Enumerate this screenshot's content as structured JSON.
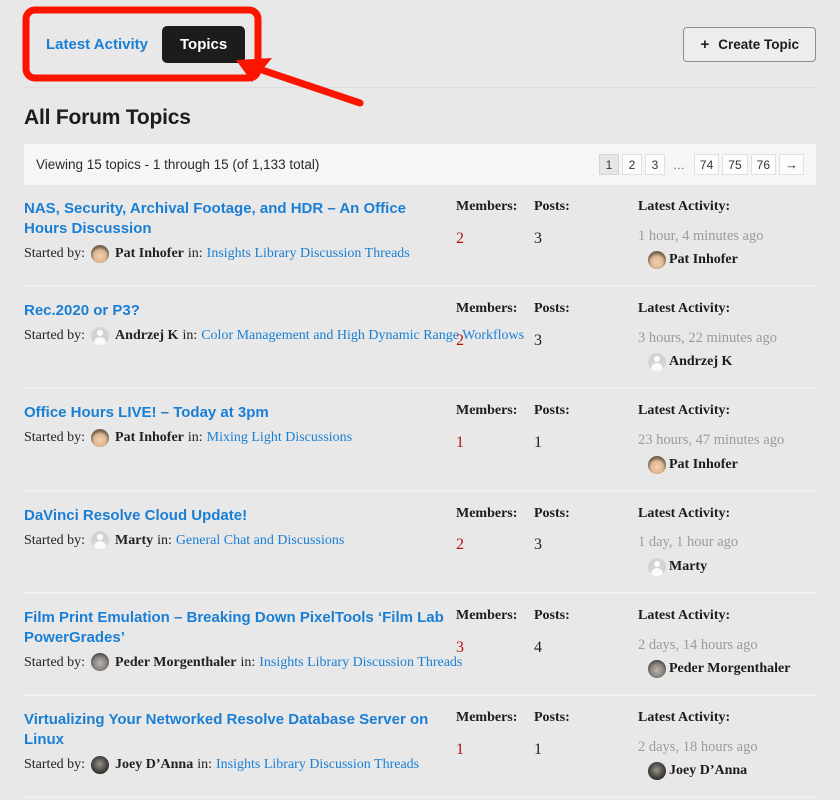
{
  "header": {
    "tab_latest_activity": "Latest Activity",
    "tab_topics": "Topics",
    "create_topic_label": "Create Topic",
    "plus_glyph": "+"
  },
  "page_title": "All Forum Topics",
  "viewbar": {
    "text": "Viewing 15 topics - 1 through 15 (of 1,133 total)",
    "pagination": [
      "1",
      "2",
      "3",
      "…",
      "74",
      "75",
      "76",
      "→"
    ],
    "current_page": "1"
  },
  "columns": {
    "members": "Members:",
    "posts": "Posts:",
    "latest_activity": "Latest Activity:",
    "started_by": "Started by:",
    "in": "in:"
  },
  "topics": [
    {
      "title": "NAS, Security, Archival Footage, and HDR – An Office Hours Discussion",
      "author": "Pat Inhofer",
      "author_avatar": "photo-pat",
      "forum": "Insights Library Discussion Threads",
      "members": "2",
      "posts": "3",
      "activity_time": "1 hour, 4 minutes ago",
      "activity_user": "Pat Inhofer",
      "activity_avatar": "photo-pat"
    },
    {
      "title": "Rec.2020 or P3?",
      "author": "Andrzej K",
      "author_avatar": "generic",
      "forum": "Color Management and High Dynamic Range Workflows",
      "members": "2",
      "posts": "3",
      "activity_time": "3 hours, 22 minutes ago",
      "activity_user": "Andrzej K",
      "activity_avatar": "generic"
    },
    {
      "title": "Office Hours LIVE! – Today at 3pm",
      "author": "Pat Inhofer",
      "author_avatar": "photo-pat",
      "forum": "Mixing Light Discussions",
      "members": "1",
      "posts": "1",
      "activity_time": "23 hours, 47 minutes ago",
      "activity_user": "Pat Inhofer",
      "activity_avatar": "photo-pat"
    },
    {
      "title": "DaVinci Resolve Cloud Update!",
      "author": "Marty",
      "author_avatar": "generic",
      "forum": "General Chat and Discussions",
      "members": "2",
      "posts": "3",
      "activity_time": "1 day, 1 hour ago",
      "activity_user": "Marty",
      "activity_avatar": "generic"
    },
    {
      "title": "Film Print Emulation – Breaking Down PixelTools ‘Film Lab PowerGrades’",
      "author": "Peder Morgenthaler",
      "author_avatar": "photo-peder",
      "forum": "Insights Library Discussion Threads",
      "members": "3",
      "posts": "4",
      "activity_time": "2 days, 14 hours ago",
      "activity_user": "Peder Morgenthaler",
      "activity_avatar": "photo-peder"
    },
    {
      "title": "Virtualizing Your Networked Resolve Database Server on Linux",
      "author": "Joey D’Anna",
      "author_avatar": "photo-joey",
      "forum": "Insights Library Discussion Threads",
      "members": "1",
      "posts": "1",
      "activity_time": "2 days, 18 hours ago",
      "activity_user": "Joey D’Anna",
      "activity_avatar": "photo-joey"
    }
  ],
  "annotation": {
    "accent_color": "#fb1500",
    "highlight_target": "Topics"
  }
}
